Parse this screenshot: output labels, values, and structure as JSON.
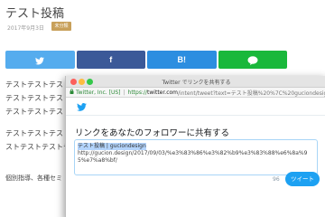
{
  "post": {
    "title": "テスト投稿",
    "date": "2017年9月3日",
    "category": "未分類"
  },
  "share": {
    "twitter_icon": "twitter-bird-icon",
    "facebook_label": "f",
    "hatena_label": "B!",
    "line_icon": "line-icon"
  },
  "body": {
    "line1": "テストテストテスト",
    "line2": "テストテストテスト",
    "line3": "テストテストテスト",
    "line4": "テストテストテスト",
    "line5": "ストテストテストテ",
    "footer": "個別指導、各種セミ"
  },
  "popup": {
    "window_title": "Twitter でリンクを共有する",
    "site_name": "Twitter, Inc. [US]",
    "url_separator": "|",
    "url_protocol": "https://",
    "url_host": "twitter.com",
    "url_rest": "/intent/tweet?text=テスト投稿%20%7C%20guciondesign...",
    "heading": "リンクをあなたのフォロワーに共有する",
    "tweet_line1": "テスト投稿 | guciondesign",
    "tweet_url": "http://gucion.design/2017/09/03/%e3%83%86%e3%82%b9%e3%83%88%e6%8a%95%e7%a8%bf/",
    "char_count": "96",
    "tweet_button": "ツイート",
    "twitter_color": "#1da1f2"
  }
}
